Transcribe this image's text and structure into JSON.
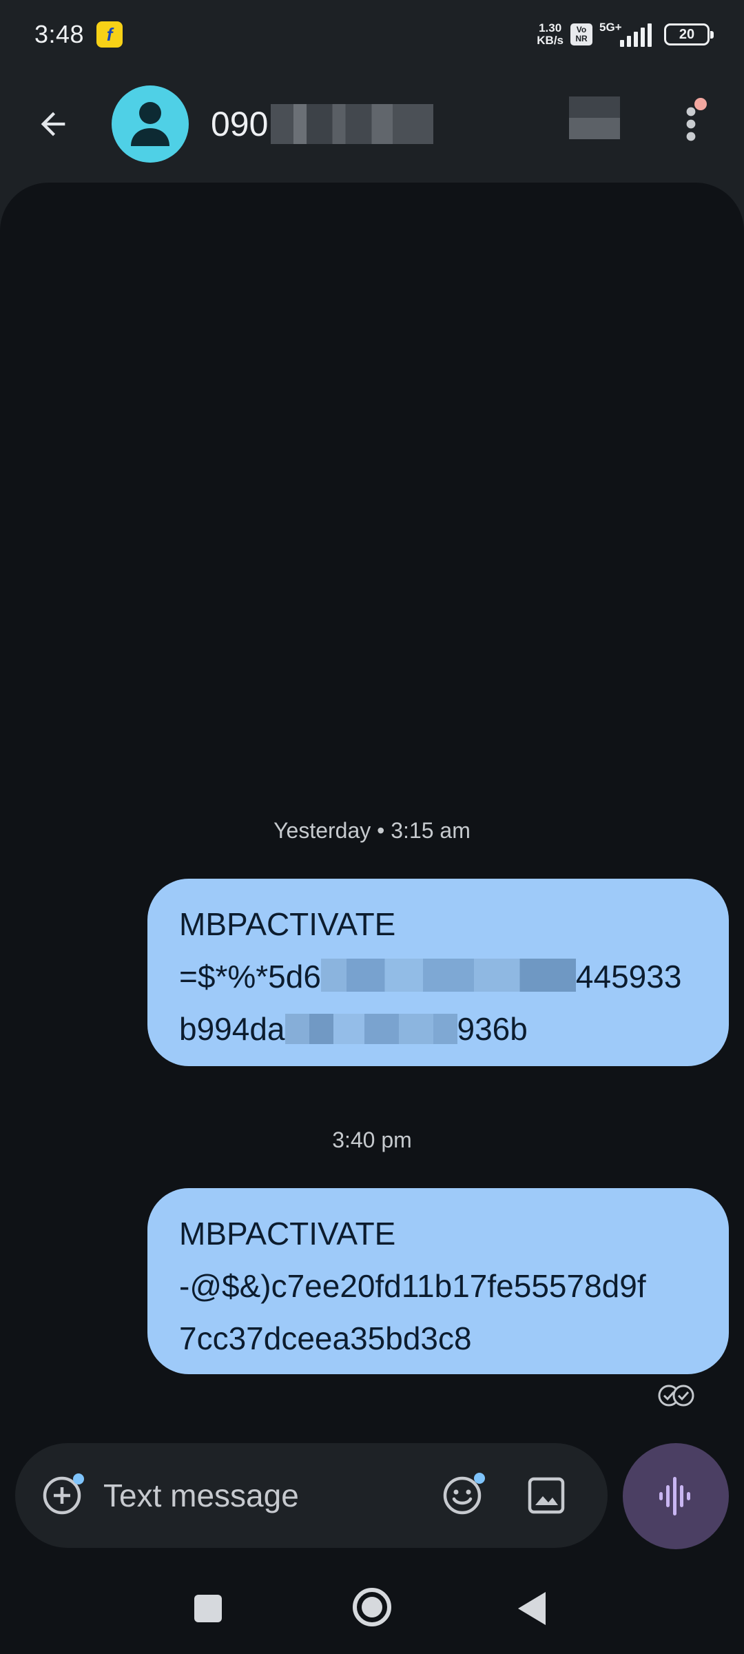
{
  "status_bar": {
    "time": "3:48",
    "net_speed_value": "1.30",
    "net_speed_unit": "KB/s",
    "volte_top": "Vo",
    "volte_bottom": "NR",
    "network_type": "5G+",
    "battery": "20"
  },
  "header": {
    "contact_name_visible": "090",
    "back_icon": "arrow-left-icon",
    "more_icon": "more-vert-icon",
    "colors": {
      "avatar": "#4fd0e6",
      "notification_dot": "#f2a7a0"
    }
  },
  "conversation": {
    "messages": [
      {
        "timestamp": "Yesterday • 3:15 am",
        "line1": "MBPACTIVATE",
        "line2_start": "=$*%*5d6",
        "line2_end": "445933",
        "line3_start": "b994da",
        "line3_end": "936b"
      },
      {
        "timestamp": "3:40 pm",
        "line1": "MBPACTIVATE",
        "line2": "-@$&)c7ee20fd11b17fe55578d9f",
        "line3": "7cc37dceea35bd3c8"
      }
    ],
    "status_icon": "double-check-icon",
    "colors": {
      "background": "#0f1216",
      "bubble": "#9ecaf9",
      "bubble_text": "#0c1c2e"
    }
  },
  "compose": {
    "placeholder": "Text message",
    "add_icon": "plus-circle-icon",
    "emoji_icon": "emoji-icon",
    "gallery_icon": "image-icon",
    "voice_icon": "voice-wave-icon",
    "colors": {
      "voice_button": "#4b3f63",
      "voice_icon": "#c9b6f2"
    }
  },
  "nav": {
    "recents_icon": "recents-square-icon",
    "home_icon": "home-circle-icon",
    "back_icon": "back-triangle-icon"
  }
}
